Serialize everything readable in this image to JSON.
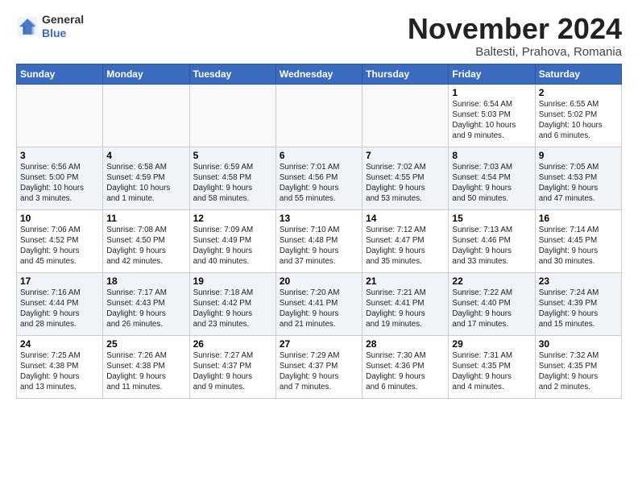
{
  "logo": {
    "line1": "General",
    "line2": "Blue"
  },
  "title": "November 2024",
  "location": "Baltesti, Prahova, Romania",
  "weekdays": [
    "Sunday",
    "Monday",
    "Tuesday",
    "Wednesday",
    "Thursday",
    "Friday",
    "Saturday"
  ],
  "weeks": [
    [
      {
        "day": "",
        "info": ""
      },
      {
        "day": "",
        "info": ""
      },
      {
        "day": "",
        "info": ""
      },
      {
        "day": "",
        "info": ""
      },
      {
        "day": "",
        "info": ""
      },
      {
        "day": "1",
        "info": "Sunrise: 6:54 AM\nSunset: 5:03 PM\nDaylight: 10 hours\nand 9 minutes."
      },
      {
        "day": "2",
        "info": "Sunrise: 6:55 AM\nSunset: 5:02 PM\nDaylight: 10 hours\nand 6 minutes."
      }
    ],
    [
      {
        "day": "3",
        "info": "Sunrise: 6:56 AM\nSunset: 5:00 PM\nDaylight: 10 hours\nand 3 minutes."
      },
      {
        "day": "4",
        "info": "Sunrise: 6:58 AM\nSunset: 4:59 PM\nDaylight: 10 hours\nand 1 minute."
      },
      {
        "day": "5",
        "info": "Sunrise: 6:59 AM\nSunset: 4:58 PM\nDaylight: 9 hours\nand 58 minutes."
      },
      {
        "day": "6",
        "info": "Sunrise: 7:01 AM\nSunset: 4:56 PM\nDaylight: 9 hours\nand 55 minutes."
      },
      {
        "day": "7",
        "info": "Sunrise: 7:02 AM\nSunset: 4:55 PM\nDaylight: 9 hours\nand 53 minutes."
      },
      {
        "day": "8",
        "info": "Sunrise: 7:03 AM\nSunset: 4:54 PM\nDaylight: 9 hours\nand 50 minutes."
      },
      {
        "day": "9",
        "info": "Sunrise: 7:05 AM\nSunset: 4:53 PM\nDaylight: 9 hours\nand 47 minutes."
      }
    ],
    [
      {
        "day": "10",
        "info": "Sunrise: 7:06 AM\nSunset: 4:52 PM\nDaylight: 9 hours\nand 45 minutes."
      },
      {
        "day": "11",
        "info": "Sunrise: 7:08 AM\nSunset: 4:50 PM\nDaylight: 9 hours\nand 42 minutes."
      },
      {
        "day": "12",
        "info": "Sunrise: 7:09 AM\nSunset: 4:49 PM\nDaylight: 9 hours\nand 40 minutes."
      },
      {
        "day": "13",
        "info": "Sunrise: 7:10 AM\nSunset: 4:48 PM\nDaylight: 9 hours\nand 37 minutes."
      },
      {
        "day": "14",
        "info": "Sunrise: 7:12 AM\nSunset: 4:47 PM\nDaylight: 9 hours\nand 35 minutes."
      },
      {
        "day": "15",
        "info": "Sunrise: 7:13 AM\nSunset: 4:46 PM\nDaylight: 9 hours\nand 33 minutes."
      },
      {
        "day": "16",
        "info": "Sunrise: 7:14 AM\nSunset: 4:45 PM\nDaylight: 9 hours\nand 30 minutes."
      }
    ],
    [
      {
        "day": "17",
        "info": "Sunrise: 7:16 AM\nSunset: 4:44 PM\nDaylight: 9 hours\nand 28 minutes."
      },
      {
        "day": "18",
        "info": "Sunrise: 7:17 AM\nSunset: 4:43 PM\nDaylight: 9 hours\nand 26 minutes."
      },
      {
        "day": "19",
        "info": "Sunrise: 7:18 AM\nSunset: 4:42 PM\nDaylight: 9 hours\nand 23 minutes."
      },
      {
        "day": "20",
        "info": "Sunrise: 7:20 AM\nSunset: 4:41 PM\nDaylight: 9 hours\nand 21 minutes."
      },
      {
        "day": "21",
        "info": "Sunrise: 7:21 AM\nSunset: 4:41 PM\nDaylight: 9 hours\nand 19 minutes."
      },
      {
        "day": "22",
        "info": "Sunrise: 7:22 AM\nSunset: 4:40 PM\nDaylight: 9 hours\nand 17 minutes."
      },
      {
        "day": "23",
        "info": "Sunrise: 7:24 AM\nSunset: 4:39 PM\nDaylight: 9 hours\nand 15 minutes."
      }
    ],
    [
      {
        "day": "24",
        "info": "Sunrise: 7:25 AM\nSunset: 4:38 PM\nDaylight: 9 hours\nand 13 minutes."
      },
      {
        "day": "25",
        "info": "Sunrise: 7:26 AM\nSunset: 4:38 PM\nDaylight: 9 hours\nand 11 minutes."
      },
      {
        "day": "26",
        "info": "Sunrise: 7:27 AM\nSunset: 4:37 PM\nDaylight: 9 hours\nand 9 minutes."
      },
      {
        "day": "27",
        "info": "Sunrise: 7:29 AM\nSunset: 4:37 PM\nDaylight: 9 hours\nand 7 minutes."
      },
      {
        "day": "28",
        "info": "Sunrise: 7:30 AM\nSunset: 4:36 PM\nDaylight: 9 hours\nand 6 minutes."
      },
      {
        "day": "29",
        "info": "Sunrise: 7:31 AM\nSunset: 4:35 PM\nDaylight: 9 hours\nand 4 minutes."
      },
      {
        "day": "30",
        "info": "Sunrise: 7:32 AM\nSunset: 4:35 PM\nDaylight: 9 hours\nand 2 minutes."
      }
    ]
  ]
}
